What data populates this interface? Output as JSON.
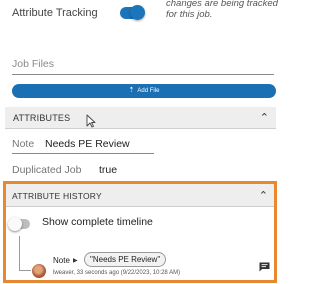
{
  "tracking": {
    "label": "Attribute Tracking",
    "enabled": true,
    "note": "changes are being tracked for this job."
  },
  "job_files": {
    "label": "Job Files",
    "add_file_button": "Add File",
    "add_file_icon": "upload-icon"
  },
  "attributes": {
    "header": "ATTRIBUTES",
    "items": [
      {
        "label": "Note",
        "value": "Needs PE Review"
      },
      {
        "label": "Duplicated Job",
        "value": "true"
      }
    ]
  },
  "history": {
    "header": "ATTRIBUTE HISTORY",
    "show_timeline_label": "Show complete timeline",
    "show_timeline_enabled": false,
    "entries": [
      {
        "attribute": "Note",
        "value": "\"Needs PE Review\"",
        "meta": "lweaver, 33 seconds ago (9/22/2023, 10:28 AM)"
      }
    ]
  },
  "colors": {
    "accent_blue": "#1b75bb",
    "highlight_orange": "#e8892f"
  }
}
